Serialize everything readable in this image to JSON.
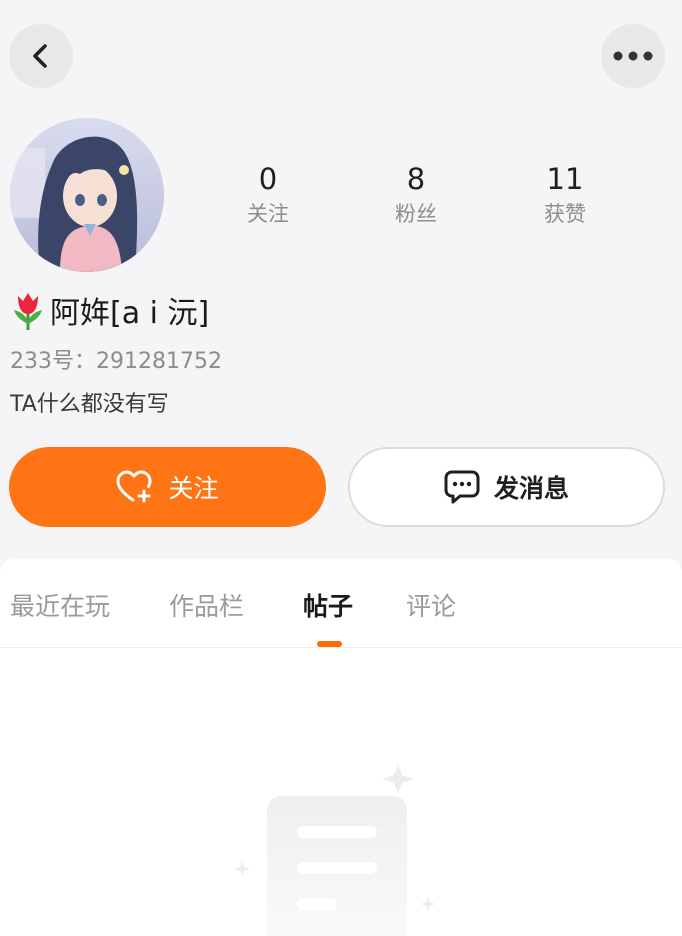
{
  "header": {
    "back_icon": "chevron-left-icon",
    "more_icon": "more-dots-icon"
  },
  "profile": {
    "avatar": "anime-girl-avatar",
    "name_icon": "tulip-emoji",
    "name": "阿姩[a i 沅]",
    "uid": "233号：291281752",
    "bio": "TA什么都没有写"
  },
  "stats": [
    {
      "value": "0",
      "label": "关注"
    },
    {
      "value": "8",
      "label": "粉丝"
    },
    {
      "value": "11",
      "label": "获赞"
    }
  ],
  "actions": {
    "follow_label": "关注",
    "follow_icon": "heart-plus-icon",
    "message_label": "发消息",
    "message_icon": "chat-bubble-icon"
  },
  "tabs": [
    {
      "label": "最近在玩",
      "active": false
    },
    {
      "label": "作品栏",
      "active": false
    },
    {
      "label": "帖子",
      "active": true
    },
    {
      "label": "评论",
      "active": false
    }
  ],
  "colors": {
    "accent": "#ff7516",
    "tab_indicator": "#ff6a00",
    "background": "#f5f5f7"
  },
  "empty_state": {
    "icon": "empty-document-icon"
  }
}
